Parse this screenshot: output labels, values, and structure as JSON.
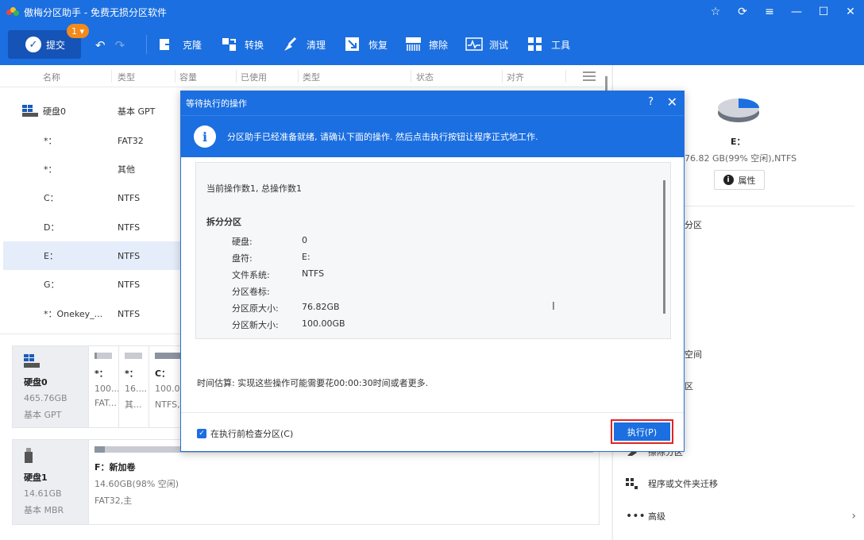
{
  "app": {
    "title": "傲梅分区助手 - 免费无损分区软件",
    "window_controls": [
      "star-icon",
      "refresh-icon",
      "menu-icon",
      "minimize-icon",
      "maximize-icon",
      "close-icon"
    ]
  },
  "toolbar": {
    "commit_label": "提交",
    "commit_badge": "1",
    "items": [
      {
        "label": "克隆",
        "icon": "clone-icon"
      },
      {
        "label": "转换",
        "icon": "convert-icon"
      },
      {
        "label": "清理",
        "icon": "clean-icon"
      },
      {
        "label": "恢复",
        "icon": "recover-icon"
      },
      {
        "label": "擦除",
        "icon": "wipe-icon"
      },
      {
        "label": "测试",
        "icon": "test-icon"
      },
      {
        "label": "工具",
        "icon": "tools-icon"
      }
    ]
  },
  "columns": [
    "名称",
    "类型",
    "容量",
    "已使用",
    "类型",
    "状态",
    "对齐"
  ],
  "partitions": [
    {
      "name": "硬盘0",
      "type": "基本 GPT"
    },
    {
      "name": "*：",
      "type": "FAT32"
    },
    {
      "name": "*：",
      "type": "其他"
    },
    {
      "name": "C：",
      "type": "NTFS"
    },
    {
      "name": "D：",
      "type": "NTFS"
    },
    {
      "name": "E：",
      "type": "NTFS"
    },
    {
      "name": "G：",
      "type": "NTFS"
    },
    {
      "name": "*：Onekey_...",
      "type": "NTFS"
    }
  ],
  "disk_map": {
    "disk0": {
      "name": "硬盘0",
      "size": "465.76GB",
      "style": "基本 GPT",
      "parts": [
        {
          "name": "*：",
          "size": "100...",
          "fs": "FAT...",
          "used": 0.15
        },
        {
          "name": "*：",
          "size": "16....",
          "fs": "其...",
          "used": 0.0
        },
        {
          "name": "C：",
          "size": "100.01",
          "fs": "NTFS,主",
          "used": 1.0
        }
      ]
    },
    "disk1": {
      "name": "硬盘1",
      "size": "14.61GB",
      "style": "基本 MBR",
      "part": {
        "name": "F：新加卷",
        "size": "14.60GB(98% 空闲)",
        "fs": "FAT32,主",
        "used": 0.02
      }
    }
  },
  "right_panel": {
    "selected_name": "E：",
    "selected_info": "76.82 GB(99% 空闲),NTFS",
    "properties_label": "属性",
    "ops": [
      {
        "label": "分区",
        "icon": ""
      },
      {
        "label": "空间",
        "icon": ""
      },
      {
        "label": "区",
        "icon": ""
      },
      {
        "label": "擦除分区",
        "icon": "wipe-partition-icon"
      },
      {
        "label": "程序或文件夹迁移",
        "icon": "app-mover-icon"
      },
      {
        "label": "高级",
        "icon": "more-icon"
      }
    ]
  },
  "dialog": {
    "title": "等待执行的操作",
    "info": "分区助手已经准备就绪, 请确认下面的操作. 然后点击执行按钮让程序正式地工作.",
    "current_ops": "当前操作数1, 总操作数1",
    "operation": "拆分分区",
    "details": [
      {
        "key": "硬盘:",
        "value": "0"
      },
      {
        "key": "盘符:",
        "value": "E:"
      },
      {
        "key": "文件系统:",
        "value": "NTFS"
      },
      {
        "key": "分区卷标:",
        "value": ""
      },
      {
        "key": "分区原大小:",
        "value": "76.82GB"
      },
      {
        "key": "分区新大小:",
        "value": "100.00GB"
      }
    ],
    "time_estimate": "时间估算: 实现这些操作可能需要花00:00:30时间或者更多.",
    "check_label": "在执行前检查分区(C)",
    "check_checked": true,
    "execute_label": "执行(P)"
  },
  "colors": {
    "brand_blue": "#1b6fe0",
    "badge_orange": "#f28a1c",
    "highlight_red": "#e02424"
  }
}
